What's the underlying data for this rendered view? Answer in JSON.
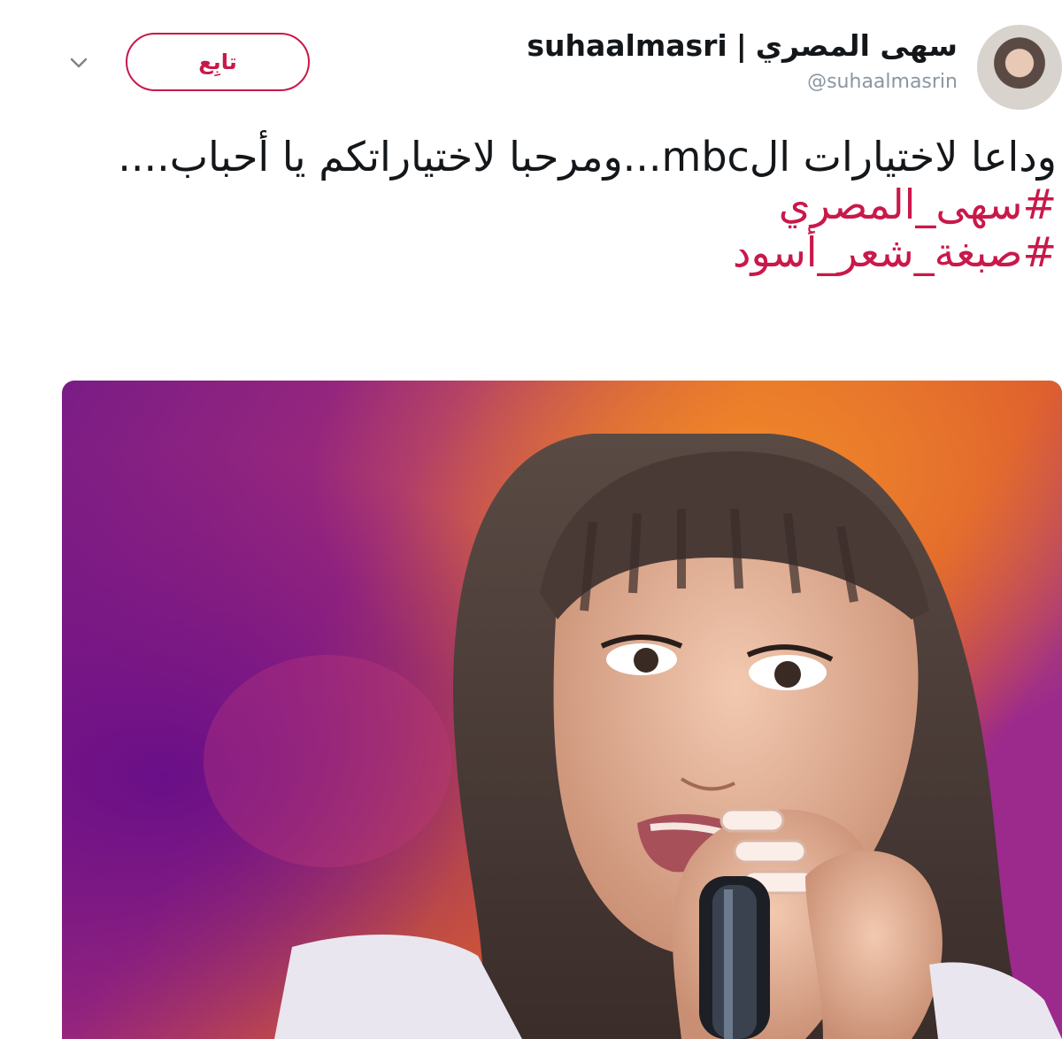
{
  "tweet": {
    "author": {
      "display_name_arabic": "سهى المصري",
      "display_name_separator": "|",
      "display_name_latin": "suhaalmasri",
      "handle": "@suhaalmasrin"
    },
    "follow_button_label": "تابِع",
    "text": "وداعا لاختيارات الmbc...ومرحبا لاختياراتكم يا أحباب....",
    "hashtags": [
      "#سهى_المصري",
      "#صبغة_شعر_أسود"
    ],
    "media": {
      "kind": "photo",
      "subject": "singer-with-microphone"
    }
  },
  "colors": {
    "accent": "#c9184a",
    "text": "#14171a",
    "muted": "#8a96a0",
    "background": "#ffffff"
  },
  "icons": {
    "caret": "chevron-down-icon",
    "avatar": "avatar"
  }
}
